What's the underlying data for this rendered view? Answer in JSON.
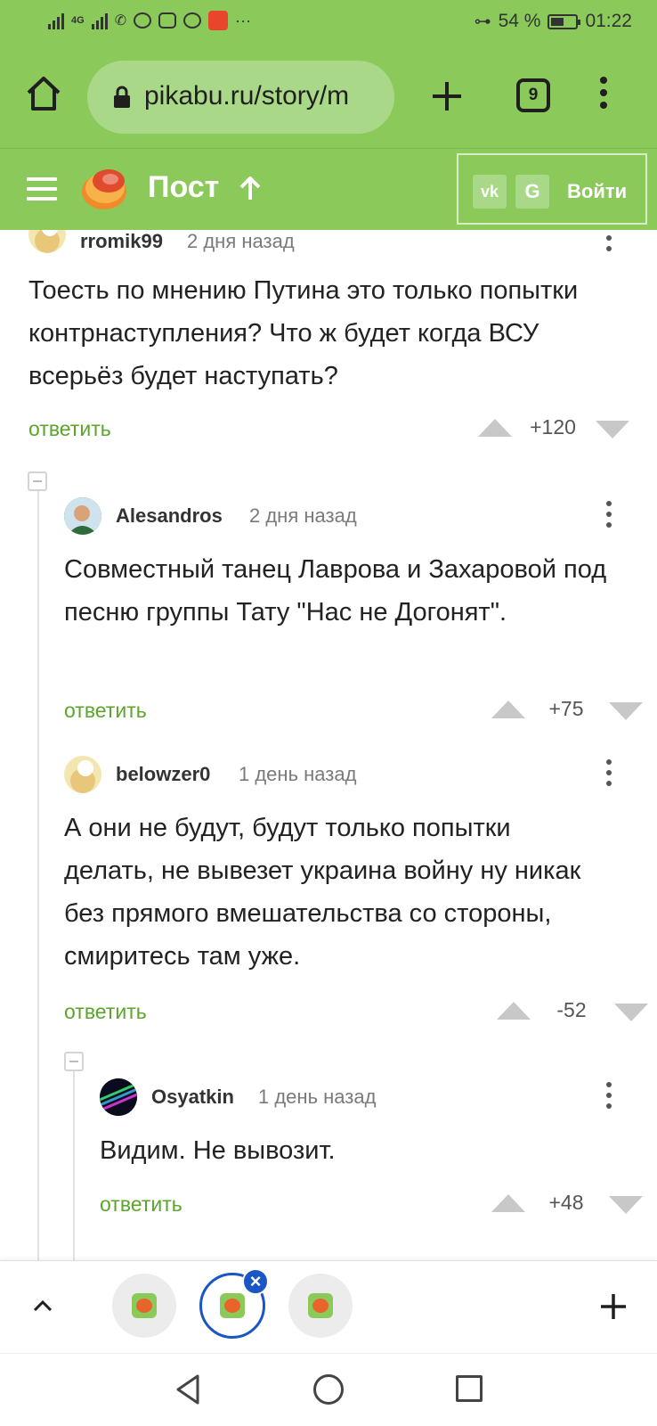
{
  "status_bar": {
    "network": "4G",
    "battery": "54 %",
    "battery_level": 0.54,
    "time": "01:22",
    "notification_icons": [
      "signal-icon",
      "missed-call-icon",
      "whatsapp-icon",
      "calendar-icon",
      "whatsapp-icon",
      "aliexpress-icon"
    ],
    "overflow": "···"
  },
  "browser": {
    "url": "pikabu.ru/story/m",
    "tab_count": "9"
  },
  "site_header": {
    "title": "Пост",
    "vk_label": "vk",
    "google_label": "G",
    "login_label": "Войти",
    "brand_color": "#8bc95a"
  },
  "comments": [
    {
      "username": "rromik99",
      "time": "2 дня назад",
      "text": "Тоесть по мнению Путина это только попытки контрнаступления? Что ж будет когда ВСУ всерьёз будет наступать?",
      "reply_label": "ответить",
      "score": "+120"
    },
    {
      "username": "Alesandros",
      "time": "2 дня назад",
      "text": "Совместный танец Лаврова и Захаровой под песню группы Тату \"Нас не Догонят\".",
      "reply_label": "ответить",
      "score": "+75"
    },
    {
      "username": "belowzer0",
      "time": "1 день назад",
      "text": "А они не будут, будут только попытки делать, не вывезет украина войну ну никак без прямого вмешательства со стороны, смиритесь там уже.",
      "reply_label": "ответить",
      "score": "-52"
    },
    {
      "username": "Osyatkin",
      "time": "1 день назад",
      "text": "Видим. Не вывозит.",
      "reply_label": "ответить",
      "score": "+48"
    }
  ],
  "colors": {
    "accent_green": "#8bc95a",
    "reply_green": "#5aa52a",
    "active_tab_blue": "#1a56c4"
  }
}
